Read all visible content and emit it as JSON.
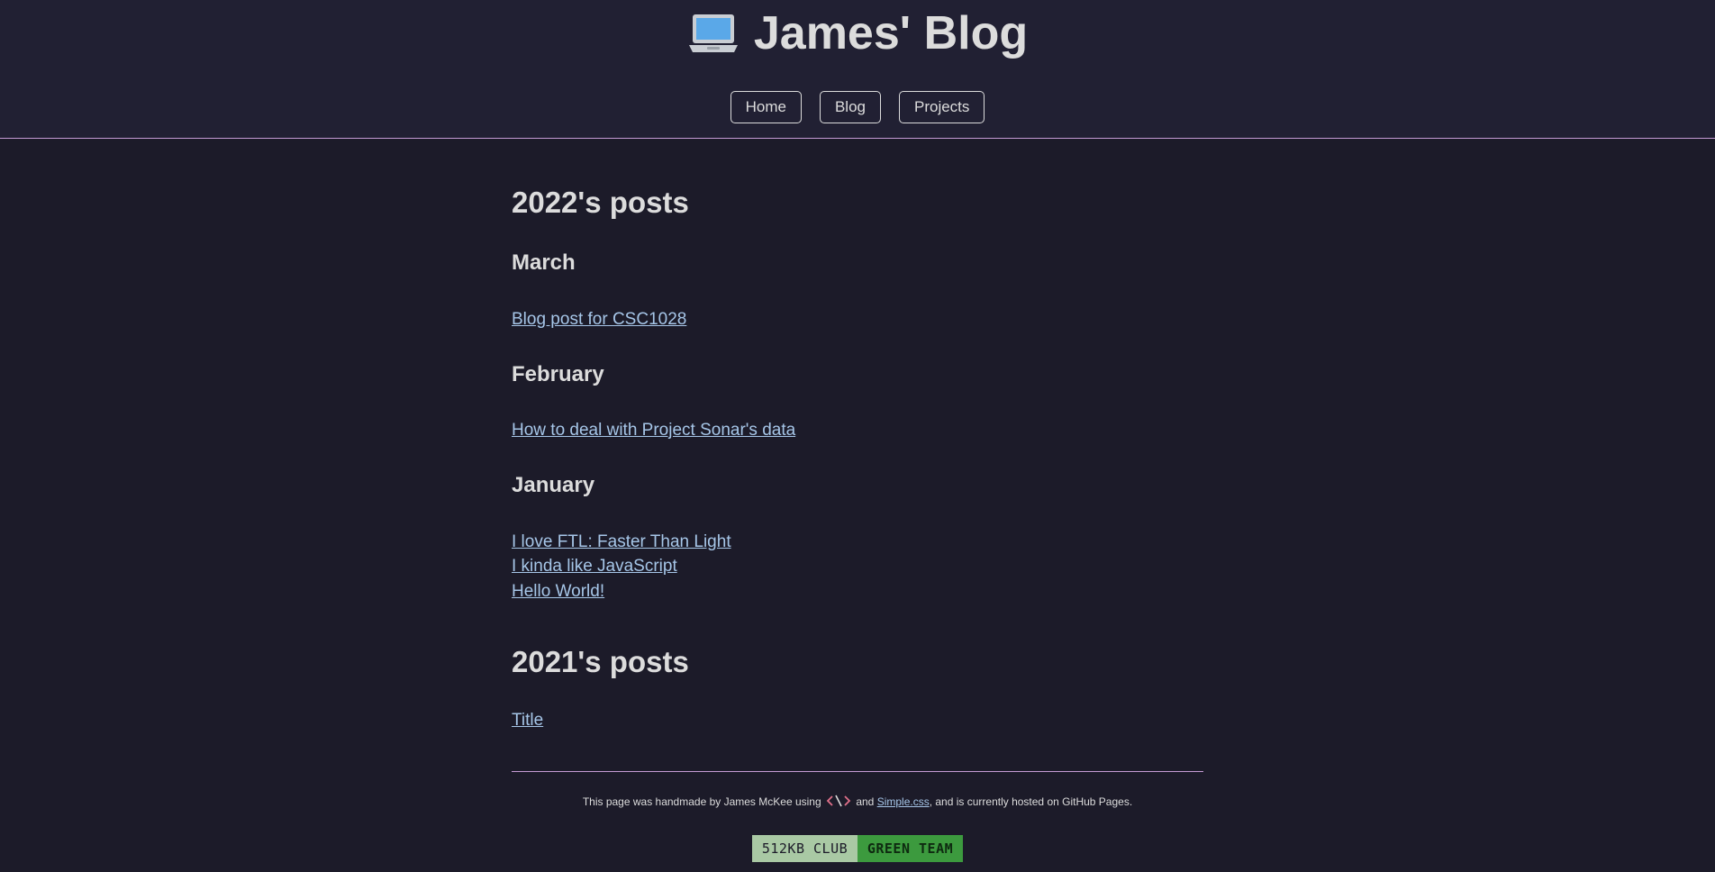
{
  "header": {
    "title": "James' Blog",
    "icon": "laptop-icon"
  },
  "nav": {
    "items": [
      {
        "label": "Home"
      },
      {
        "label": "Blog"
      },
      {
        "label": "Projects"
      }
    ]
  },
  "sections": [
    {
      "heading": "2022's posts",
      "months": [
        {
          "name": "March",
          "posts": [
            "Blog post for CSC1028"
          ]
        },
        {
          "name": "February",
          "posts": [
            "How to deal with Project Sonar's data"
          ]
        },
        {
          "name": "January",
          "posts": [
            "I love FTL: Faster Than Light",
            "I kinda like JavaScript",
            "Hello World!"
          ]
        }
      ]
    },
    {
      "heading": "2021's posts",
      "posts": [
        "Title"
      ]
    }
  ],
  "footer": {
    "text_before": "This page was handmade by James McKee using ",
    "text_and": " and ",
    "link_label": "Simple.css",
    "text_after": ", and is currently hosted on GitHub Pages.",
    "icon": "code-icon"
  },
  "badge": {
    "left_label": "512KB CLUB",
    "right_label": "GREEN TEAM"
  },
  "colors": {
    "background": "#1c1b29",
    "header_background": "#212033",
    "accent_rule": "#c59bd4",
    "link": "#a6c6e8",
    "badge_left": "#a9c9a4",
    "badge_right": "#3c9a3e"
  }
}
